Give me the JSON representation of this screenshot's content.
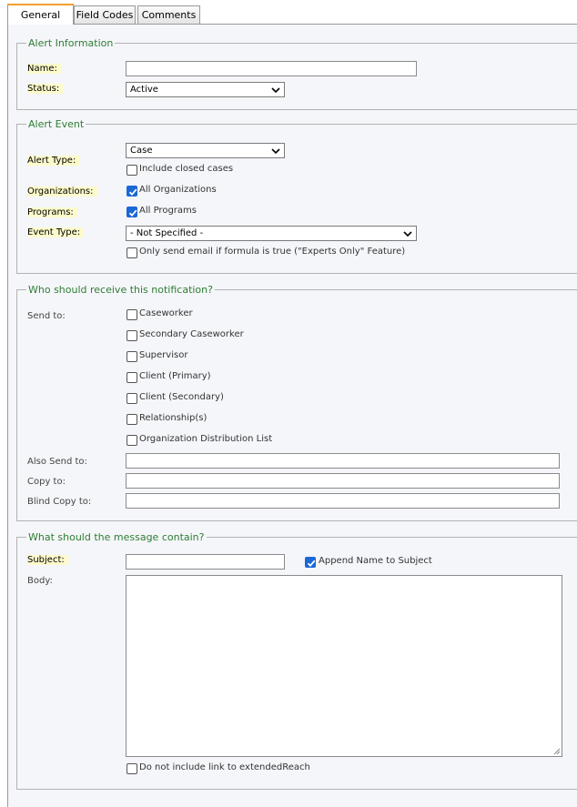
{
  "tabs": [
    "General",
    "Field Codes",
    "Comments"
  ],
  "alert_information": {
    "legend": "Alert Information",
    "name_label": "Name:",
    "name_value": "",
    "status_label": "Status:",
    "status_value": "Active"
  },
  "alert_event": {
    "legend": "Alert Event",
    "alert_type_label": "Alert Type:",
    "alert_type_value": "Case",
    "include_closed_label": "Include closed cases",
    "include_closed_checked": false,
    "organizations_label": "Organizations:",
    "all_organizations_label": "All Organizations",
    "all_organizations_checked": true,
    "programs_label": "Programs:",
    "all_programs_label": "All Programs",
    "all_programs_checked": true,
    "event_type_label": "Event Type:",
    "event_type_value": "- Not Specified -",
    "formula_label": "Only send email if formula is true (\"Experts Only\" Feature)",
    "formula_checked": false
  },
  "recipients": {
    "legend": "Who should receive this notification?",
    "send_to_label": "Send to:",
    "options": [
      {
        "label": "Caseworker",
        "checked": false
      },
      {
        "label": "Secondary Caseworker",
        "checked": false
      },
      {
        "label": "Supervisor",
        "checked": false
      },
      {
        "label": "Client (Primary)",
        "checked": false
      },
      {
        "label": "Client (Secondary)",
        "checked": false
      },
      {
        "label": "Relationship(s)",
        "checked": false
      },
      {
        "label": "Organization Distribution List",
        "checked": false
      }
    ],
    "also_send_label": "Also Send to:",
    "copy_to_label": "Copy to:",
    "blind_copy_label": "Blind Copy to:"
  },
  "message": {
    "legend": "What should the message contain?",
    "subject_label": "Subject:",
    "subject_value": "",
    "append_name_label": "Append Name to Subject",
    "append_name_checked": true,
    "body_label": "Body:",
    "body_value": "",
    "no_link_label": "Do not include link to extendedReach",
    "no_link_checked": false
  },
  "colors": {
    "legend_green": "#2e7d32",
    "required_label_bg": "#fdfbcc",
    "checkbox_blue": "#1b68d6",
    "active_tab_accent": "#f0a030"
  }
}
